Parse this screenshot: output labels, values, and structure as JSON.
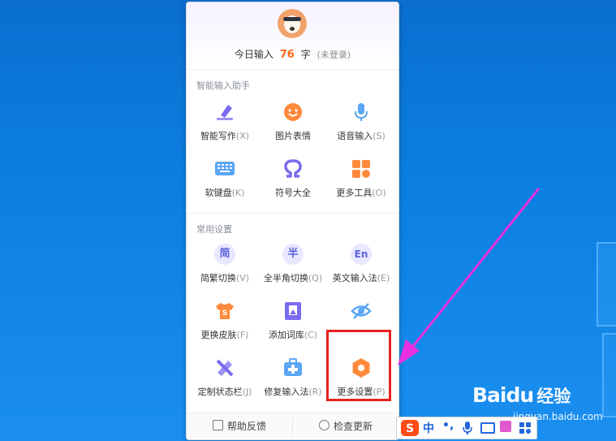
{
  "header": {
    "today_prefix": "今日输入",
    "today_count": "76",
    "today_suffix": "字",
    "login_status": "(未登录)"
  },
  "sections": {
    "smart": {
      "title": "智能输入助手",
      "items": [
        {
          "label": "智能写作",
          "key": "(X)",
          "icon": "pen-icon",
          "color": "#7a6cf0"
        },
        {
          "label": "图片表情",
          "key": "",
          "icon": "smiley-icon",
          "color": "#ff8a3c"
        },
        {
          "label": "语音输入",
          "key": "(S)",
          "icon": "microphone-icon",
          "color": "#5ba6f5"
        },
        {
          "label": "软键盘",
          "key": "(K)",
          "icon": "keyboard-icon",
          "color": "#5ba6f5"
        },
        {
          "label": "符号大全",
          "key": "",
          "icon": "omega-icon",
          "color": "#7a6cf0"
        },
        {
          "label": "更多工具",
          "key": "(O)",
          "icon": "grid-icon",
          "color": "#ff8a3c"
        }
      ]
    },
    "common": {
      "title": "常用设置",
      "items": [
        {
          "label": "简繁切换",
          "key": "(V)",
          "icon": "simplified-traditional-icon",
          "glyph": "简"
        },
        {
          "label": "全半角切换",
          "key": "(Q)",
          "icon": "fullwidth-halfwidth-icon",
          "glyph": "半"
        },
        {
          "label": "英文输入法",
          "key": "(E)",
          "icon": "english-icon",
          "glyph": "En"
        },
        {
          "label": "更换皮肤",
          "key": "(F)",
          "icon": "tshirt-icon"
        },
        {
          "label": "添加词库",
          "key": "(C)",
          "icon": "dictionary-icon"
        },
        {
          "label": "",
          "key": "",
          "icon": "hide-eye-icon"
        },
        {
          "label": "定制状态栏",
          "key": "(J)",
          "icon": "ruler-pencil-icon"
        },
        {
          "label": "修复输入法",
          "key": "(R)",
          "icon": "repair-kit-icon"
        },
        {
          "label": "更多设置",
          "key": "(P)",
          "icon": "hex-gear-icon"
        }
      ]
    }
  },
  "footer": {
    "help_label": "帮助反馈",
    "update_label": "检查更新"
  },
  "imebar": {
    "mode": "中",
    "punct": "•,",
    "icons": [
      "sogou-s-icon",
      "microphone-icon",
      "keyboard-icon",
      "tshirt-icon",
      "grid-icon"
    ]
  },
  "watermark": {
    "brand": "Baidu",
    "cn": "经验",
    "url": "jingyan.baidu.com"
  },
  "colors": {
    "accent_orange": "#ff6a13",
    "highlight_red": "#e8211f",
    "arrow_magenta": "#e830e0",
    "desktop_blue": "#0b7fe0"
  }
}
